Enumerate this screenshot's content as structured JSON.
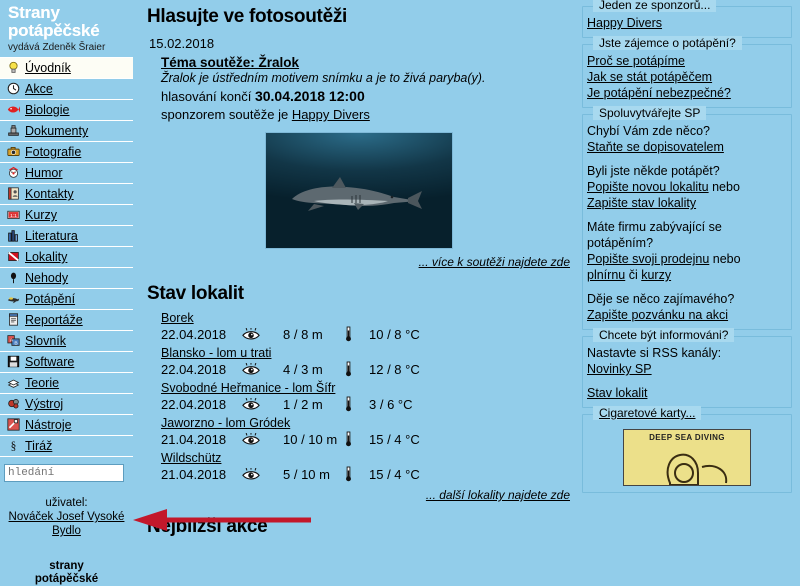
{
  "site": {
    "title_line1": "Strany",
    "title_line2": "potápěčské",
    "publisher": "vydává Zdeněk Šraier",
    "footer_brand_line1": "strany",
    "footer_brand_line2": "potápěčské"
  },
  "colors": {
    "background": "#92cdea",
    "legend_bg": "#a8d9ef",
    "box_border": "#79bcdc",
    "active_item": "#fdfdf5",
    "arrow": "#c3182b",
    "brand_text": "#ffffff",
    "card_bg": "#ece08a"
  },
  "sidebar": {
    "items": [
      {
        "label": "Úvodník",
        "icon": "lightbulb-icon",
        "active": true
      },
      {
        "label": "Akce",
        "icon": "clock-icon",
        "active": false
      },
      {
        "label": "Biologie",
        "icon": "fish-icon",
        "active": false
      },
      {
        "label": "Dokumenty",
        "icon": "stamp-icon",
        "active": false
      },
      {
        "label": "Fotografie",
        "icon": "camera-icon",
        "active": false
      },
      {
        "label": "Humor",
        "icon": "clown-icon",
        "active": false
      },
      {
        "label": "Kontakty",
        "icon": "address-book-icon",
        "active": false
      },
      {
        "label": "Kurzy",
        "icon": "certificate-icon",
        "active": false
      },
      {
        "label": "Literatura",
        "icon": "books-icon",
        "active": false
      },
      {
        "label": "Lokality",
        "icon": "dive-flag-icon",
        "active": false
      },
      {
        "label": "Nehody",
        "icon": "balloon-icon",
        "active": false
      },
      {
        "label": "Potápění",
        "icon": "diver-icon",
        "active": false
      },
      {
        "label": "Reportáže",
        "icon": "notepad-icon",
        "active": false
      },
      {
        "label": "Slovník",
        "icon": "dictionary-icon",
        "active": false
      },
      {
        "label": "Software",
        "icon": "floppy-icon",
        "active": false
      },
      {
        "label": "Teorie",
        "icon": "book-icon",
        "active": false
      },
      {
        "label": "Výstroj",
        "icon": "gear-equipment-icon",
        "active": false
      },
      {
        "label": "Nástroje",
        "icon": "tools-icon",
        "active": false
      },
      {
        "label": "Tiráž",
        "icon": "paragraph-icon",
        "active": false
      }
    ],
    "search": {
      "placeholder": "hledání",
      "value": ""
    },
    "user": {
      "label": "uživatel:",
      "name": "Nováček Josef Vysoké Bydlo"
    }
  },
  "main": {
    "contest": {
      "heading": "Hlasujte ve fotosoutěži",
      "date": "15.02.2018",
      "topic_link": "Téma soutěže: Žralok",
      "description": "Žralok je ústředním motivem snímku a je to živá paryba(y).",
      "deadline_prefix": "hlasování končí",
      "deadline": "30.04.2018 12:00",
      "sponsor_prefix": "sponzorem soutěže je",
      "sponsor": "Happy Divers",
      "photo_alt": "shark-photo",
      "more_link": "... více k soutěži najdete zde"
    },
    "locations": {
      "heading": "Stav lokalit",
      "rows": [
        {
          "name": "Borek",
          "date": "22.04.2018",
          "visibility": "8 / 8 m",
          "temperature": "10 / 8 °C"
        },
        {
          "name": "Blansko - lom u trati",
          "date": "22.04.2018",
          "visibility": "4 / 3 m",
          "temperature": "12 / 8 °C"
        },
        {
          "name": "Svobodné Heřmanice - lom Šífr",
          "date": "22.04.2018",
          "visibility": "1 / 2 m",
          "temperature": "3 / 6 °C"
        },
        {
          "name": "Jaworzno - lom Gródek",
          "date": "21.04.2018",
          "visibility": "10 / 10 m",
          "temperature": "15 / 4 °C"
        },
        {
          "name": "Wildschütz",
          "date": "21.04.2018",
          "visibility": "5 / 10 m",
          "temperature": "15 / 4 °C"
        }
      ],
      "more_link": "... další lokality najdete zde"
    },
    "events": {
      "heading": "Nejbližší akce"
    }
  },
  "right": {
    "boxes": [
      {
        "legend": "Jeden ze sponzorů...",
        "lines": [
          {
            "text": "Happy Divers",
            "link": true,
            "gap": false
          }
        ]
      },
      {
        "legend": "Jste zájemce o potápění?",
        "lines": [
          {
            "text": "Proč se potápíme",
            "link": true,
            "gap": false
          },
          {
            "text": "Jak se stát potápěčem",
            "link": true,
            "gap": false
          },
          {
            "text": "Je potápění nebezpečné?",
            "link": true,
            "gap": false
          }
        ]
      },
      {
        "legend": "Spoluvytvářejte SP",
        "lines": [
          {
            "text": "Chybí Vám zde něco?",
            "link": false,
            "gap": false
          },
          {
            "text": "Staňte se dopisovatelem",
            "link": true,
            "gap": false
          },
          {
            "text": "Byli jste někde potápět?",
            "link": false,
            "gap": true
          },
          {
            "text": "Popište novou lokalitu nebo",
            "link": "partial",
            "link_part": "Popište novou lokalitu",
            "tail": " nebo",
            "gap": false
          },
          {
            "text": "Zapište stav lokality",
            "link": true,
            "gap": false
          },
          {
            "text": "Máte firmu zabývající se",
            "link": false,
            "gap": true
          },
          {
            "text": "potápěním?",
            "link": false,
            "gap": false
          },
          {
            "text": "Popište svoji prodejnu nebo",
            "link": "partial",
            "link_part": "Popište svoji prodejnu",
            "tail": " nebo",
            "gap": false
          },
          {
            "text": "plnírnu či kurzy",
            "link": "two",
            "link_part": "plnírnu",
            "mid": " či ",
            "link_part2": "kurzy",
            "gap": false
          },
          {
            "text": "Děje se něco zajímavého?",
            "link": false,
            "gap": true
          },
          {
            "text": "Zapište pozvánku na akci",
            "link": true,
            "gap": false
          }
        ]
      },
      {
        "legend": "Chcete být informováni?",
        "lines": [
          {
            "text": "Nastavte si RSS kanály:",
            "link": false,
            "gap": false
          },
          {
            "text": "Novinky SP",
            "link": true,
            "gap": false
          },
          {
            "text": "Stav lokalit",
            "link": true,
            "gap": true
          }
        ]
      },
      {
        "legend": "Cigaretové karty...",
        "legend_link": true,
        "card_caption": "DEEP SEA DIVING",
        "lines": []
      }
    ]
  },
  "annotation": {
    "arrow": "red-left-arrow"
  }
}
